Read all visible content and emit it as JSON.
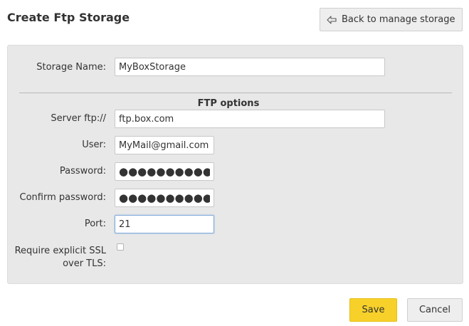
{
  "header": {
    "title": "Create Ftp Storage",
    "back_label": "Back to manage storage"
  },
  "form": {
    "storage_name": {
      "label": "Storage Name:",
      "value": "MyBoxStorage"
    },
    "section_title": "FTP options",
    "server": {
      "label": "Server ftp://",
      "value": "ftp.box.com"
    },
    "user": {
      "label": "User:",
      "value": "MyMail@gmail.com"
    },
    "password": {
      "label": "Password:",
      "value": "●●●●●●●●●●"
    },
    "confirm_password": {
      "label": "Confirm password:",
      "value": "●●●●●●●●●●"
    },
    "port": {
      "label": "Port:",
      "value": "21"
    },
    "ssl": {
      "label_line1": "Require explicit SSL",
      "label_line2": "over TLS:",
      "checked": false
    }
  },
  "actions": {
    "save_label": "Save",
    "cancel_label": "Cancel"
  },
  "colors": {
    "accent": "#f7d12a",
    "panel_bg": "#e8e8e8",
    "focus_border": "#7fa7d8"
  }
}
